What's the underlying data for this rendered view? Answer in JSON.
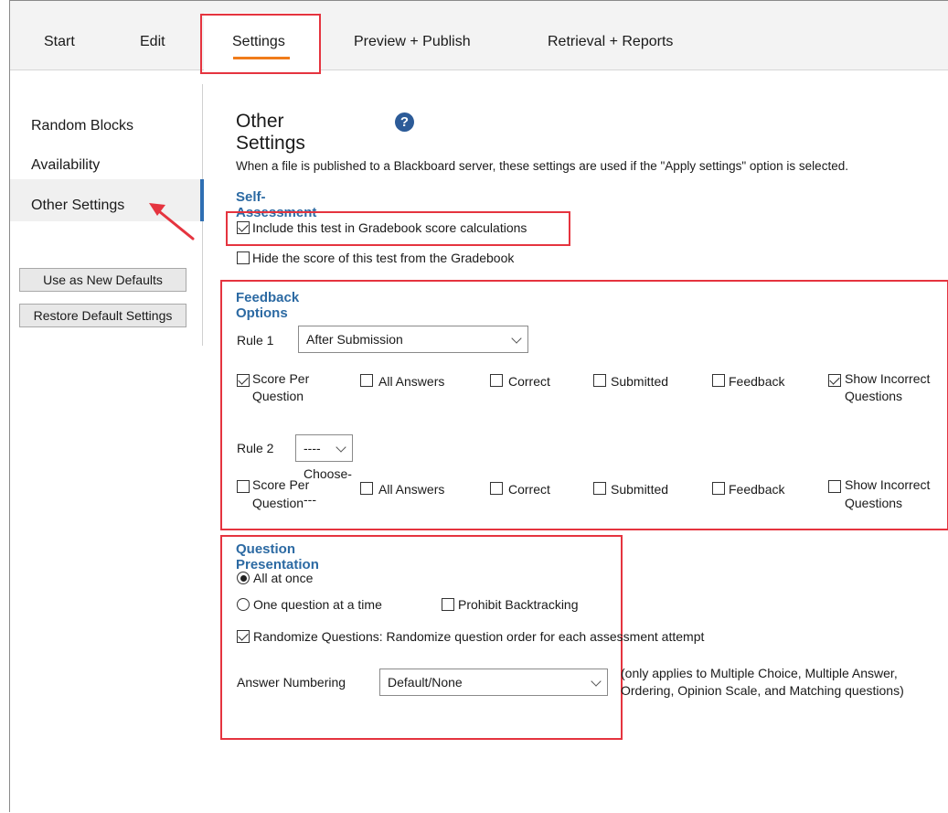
{
  "tabs": [
    "Start",
    "Edit",
    "Settings",
    "Preview + Publish",
    "Retrieval + Reports"
  ],
  "sidebar": {
    "items": [
      "Random Blocks",
      "Availability",
      "Other Settings"
    ],
    "buttons": [
      "Use as New Defaults",
      "Restore Default Settings"
    ]
  },
  "main": {
    "title": "Other Settings",
    "help_glyph": "?",
    "intro": "When a file is published to a Blackboard server, these settings are used if the \"Apply settings\" option is selected.",
    "self_assessment": {
      "heading": "Self-Assessment",
      "include": "Include this test in Gradebook score calculations",
      "hide": "Hide the score of this test from the  Gradebook"
    },
    "feedback": {
      "heading": "Feedback Options",
      "rule1_label": "Rule 1",
      "rule1_value": "After Submission",
      "rule2_label": "Rule 2",
      "rule2_value": "----Choose----",
      "opt_score_1": "Score Per",
      "opt_score_2": "Question",
      "opt_all": "All Answers",
      "opt_correct": "Correct",
      "opt_submitted": "Submitted",
      "opt_feedback": "Feedback",
      "opt_incorrect_1": "Show Incorrect",
      "opt_incorrect_2": "Questions"
    },
    "presentation": {
      "heading": "Question Presentation",
      "all_at_once": "All at once",
      "one_at_time": "One question at a time",
      "prohibit": "Prohibit Backtracking",
      "randomize": "Randomize Questions:  Randomize question order for each assessment attempt",
      "numbering_label": "Answer Numbering",
      "numbering_value": "Default/None",
      "note_1": "(only applies to Multiple Choice, Multiple Answer,",
      "note_2": "Ordering, Opinion Scale, and Matching questions)"
    }
  },
  "colors": {
    "accent": "#f07c1b",
    "highlight": "#e5343f",
    "heading": "#2c6aa3"
  }
}
